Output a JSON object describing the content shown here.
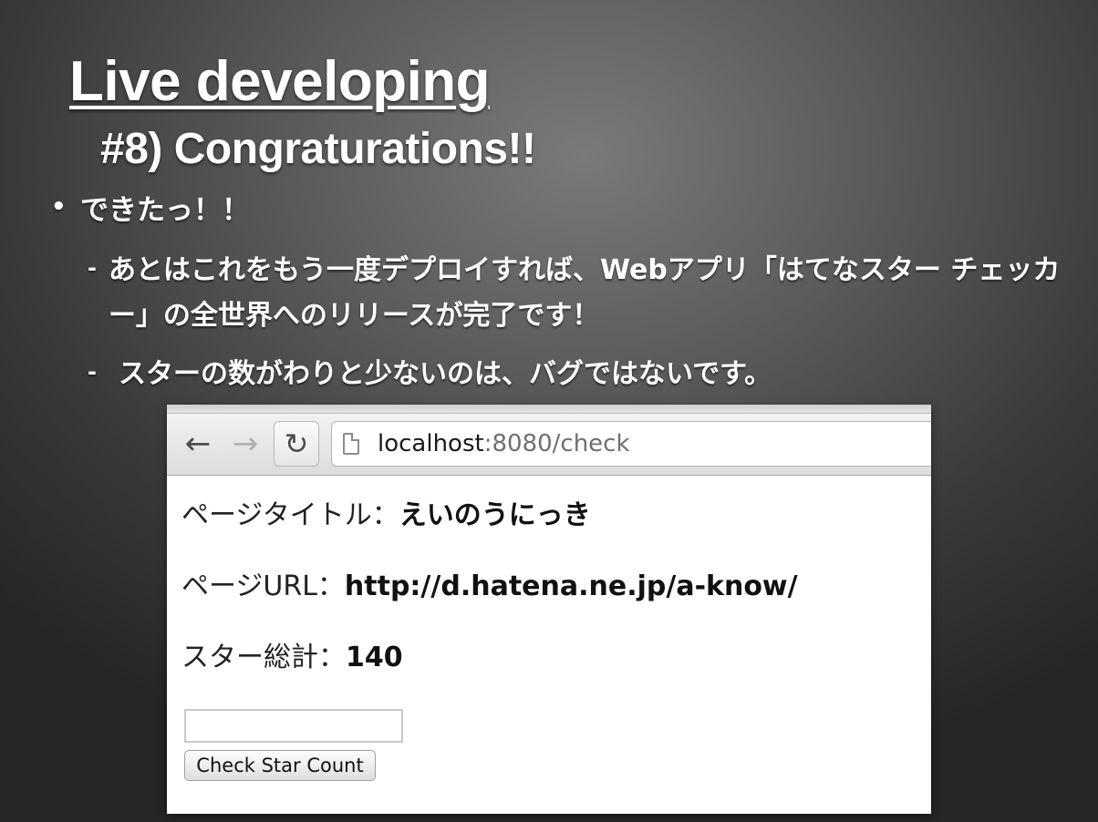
{
  "slide": {
    "title": "Live developing",
    "subtitle": "#8) Congraturations!!",
    "bullets": [
      {
        "marker": "•",
        "text": "できたっ！！"
      },
      {
        "marker": "-",
        "text": "あとはこれをもう一度デプロイすれば、Webアプリ「はてなスター チェッカー」の全世界へのリリースが完了です！"
      },
      {
        "marker": "-",
        "text": "スターの数がわりと少ないのは、バグではないです。"
      }
    ]
  },
  "browser": {
    "icons": {
      "back": "back-arrow-icon",
      "forward": "forward-arrow-icon",
      "reload": "reload-icon",
      "page": "page-icon"
    },
    "url_host": "localhost",
    "url_rest": ":8080/check",
    "page": {
      "title_label": "ページタイトル：",
      "title_value": "えいのうにっき",
      "url_label": "ページURL：",
      "url_value": "http://d.hatena.ne.jp/a-know/",
      "stars_label": "スター総計：",
      "stars_value": "140",
      "input_value": "",
      "button_label": "Check Star Count"
    }
  },
  "colors": {
    "slide_text": "#ffffff",
    "page_text": "#111111",
    "background_dark": "#262626"
  }
}
